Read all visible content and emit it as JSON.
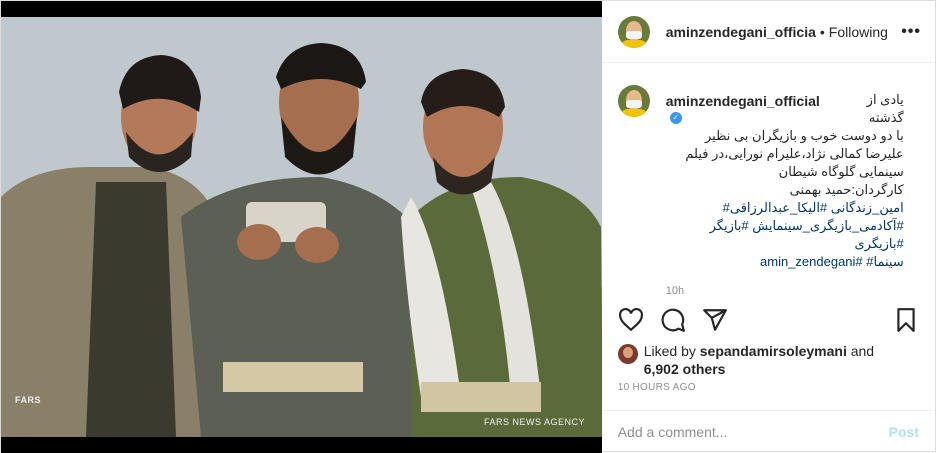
{
  "header": {
    "username": "aminzendegani_officia",
    "separator": "•",
    "follow_status": "Following",
    "more_icon": "more-horizontal-icon"
  },
  "media": {
    "watermark_small": "FARS",
    "watermark_agency": "FARS NEWS AGENCY"
  },
  "caption": {
    "username": "aminzendegani_official",
    "verified_icon": "verified-badge-icon",
    "line1": "یادی از گذشته",
    "line2": "با دو دوست خوب و بازیگران بی نظیر علیرضا کمالی نژاد،علیرام نورایی،در فیلم سینمایی گلوگاه شیطان",
    "line3": "کارگردان:حمید بهمنی",
    "tags1": "امین_زندگانی #الیکا_عبدالرزاقی#",
    "tags2": "#آکادمی_بازیگری_سینمایش #بازیگر #بازیگری",
    "tags3": "سینما# #amin_zendegani",
    "time": "10h"
  },
  "actions": {
    "like_icon": "heart-icon",
    "comment_icon": "comment-icon",
    "share_icon": "share-icon",
    "save_icon": "bookmark-icon"
  },
  "likes": {
    "prefix": "Liked by",
    "user": "sepandamirsoleymani",
    "and": "and",
    "count": "6,902 others"
  },
  "date": "10 HOURS AGO",
  "comment": {
    "placeholder": "Add a comment...",
    "post_label": "Post"
  },
  "colors": {
    "link": "#00376b",
    "verified": "#3897f0",
    "muted": "#8e8e8e",
    "post_disabled": "#b2dffc"
  }
}
